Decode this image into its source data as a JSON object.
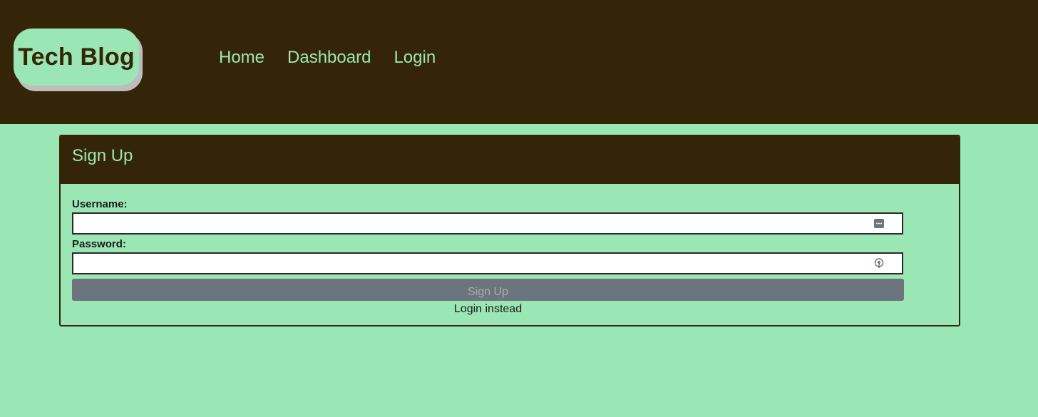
{
  "header": {
    "logo_text": "Tech Blog",
    "nav": [
      {
        "label": "Home"
      },
      {
        "label": "Dashboard"
      },
      {
        "label": "Login"
      }
    ]
  },
  "signup": {
    "title": "Sign Up",
    "username_label": "Username:",
    "username_value": "",
    "username_icon": "password-manager-icon",
    "password_label": "Password:",
    "password_value": "",
    "password_icon": "key-icon",
    "submit_label": "Sign Up",
    "alt_link": "Login instead"
  },
  "colors": {
    "header_bg": "#352508",
    "page_bg": "#9ae6b4",
    "button_bg": "#6c757d"
  }
}
